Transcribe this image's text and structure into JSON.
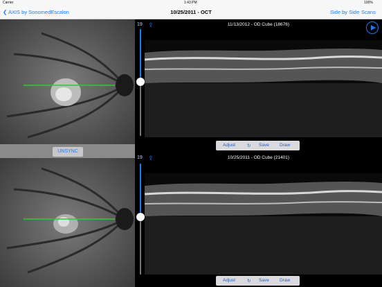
{
  "status": {
    "carrier": "Carrier",
    "time": "1:43 PM",
    "battery": "100%"
  },
  "nav": {
    "back": "AXIS by SonomedEscalon",
    "title": "10/25/2011 - OCT",
    "side_by_side": "Side by Side",
    "scans": "Scans"
  },
  "unsync": "UNSYNC",
  "panels": [
    {
      "number": "19",
      "title": "11/13/2012 - OD Cube (18676)",
      "adjust": "Adjust",
      "save": "Save",
      "draw": "Draw"
    },
    {
      "number": "19",
      "title": "10/25/2011 - OD Cube (21401)",
      "adjust": "Adjust",
      "save": "Save",
      "draw": "Draw"
    }
  ],
  "colors": {
    "accent": "#1b7cf2",
    "scanline": "#2ecc2e"
  },
  "icons": [
    "back-chevron-icon",
    "share-icon",
    "play-icon",
    "refresh-icon"
  ]
}
